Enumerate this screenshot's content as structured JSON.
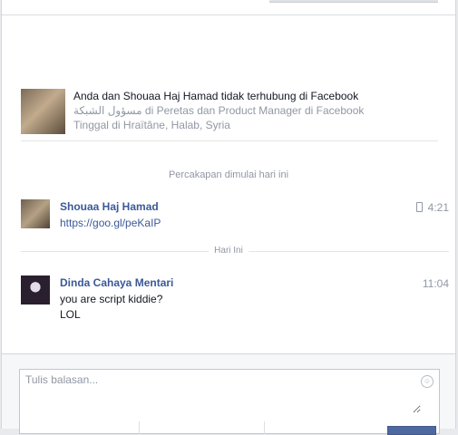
{
  "context": {
    "title": "Anda dan Shouaa Haj Hamad tidak terhubung di Facebook",
    "job": "مسؤول الشبكة di Peretas dan Product Manager di Facebook",
    "location": "Tinggal di Hraïtâne, Halab, Syria"
  },
  "conversation_start": "Percakapan dimulai hari ini",
  "messages": [
    {
      "name": "Shouaa Haj Hamad",
      "time": "4:21",
      "lines": [
        "https://goo.gl/peKaIP"
      ]
    },
    {
      "name": "Dinda Cahaya Mentari",
      "time": "11:04",
      "lines": [
        "you are script kiddie?",
        "LOL"
      ]
    }
  ],
  "today_label": "Hari Ini",
  "composer": {
    "placeholder": "Tulis balasan..."
  }
}
